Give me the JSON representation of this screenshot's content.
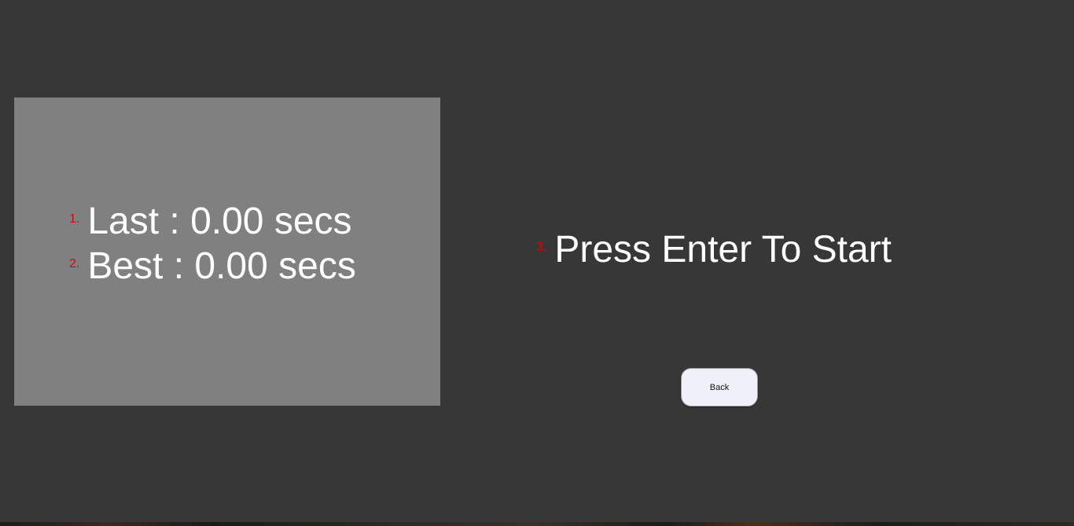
{
  "stats": {
    "last": {
      "marker": "1.",
      "text": "Last : 0.00 secs"
    },
    "best": {
      "marker": "2.",
      "text": "Best : 0.00 secs"
    }
  },
  "prompt": {
    "marker": "3.",
    "text": "Press Enter To Start"
  },
  "back_button": {
    "label": "Back"
  },
  "colors": {
    "background": "#383738",
    "panel": "#808080",
    "marker": "#e00000",
    "text": "#ffffff",
    "button": "#f0f0fa"
  }
}
